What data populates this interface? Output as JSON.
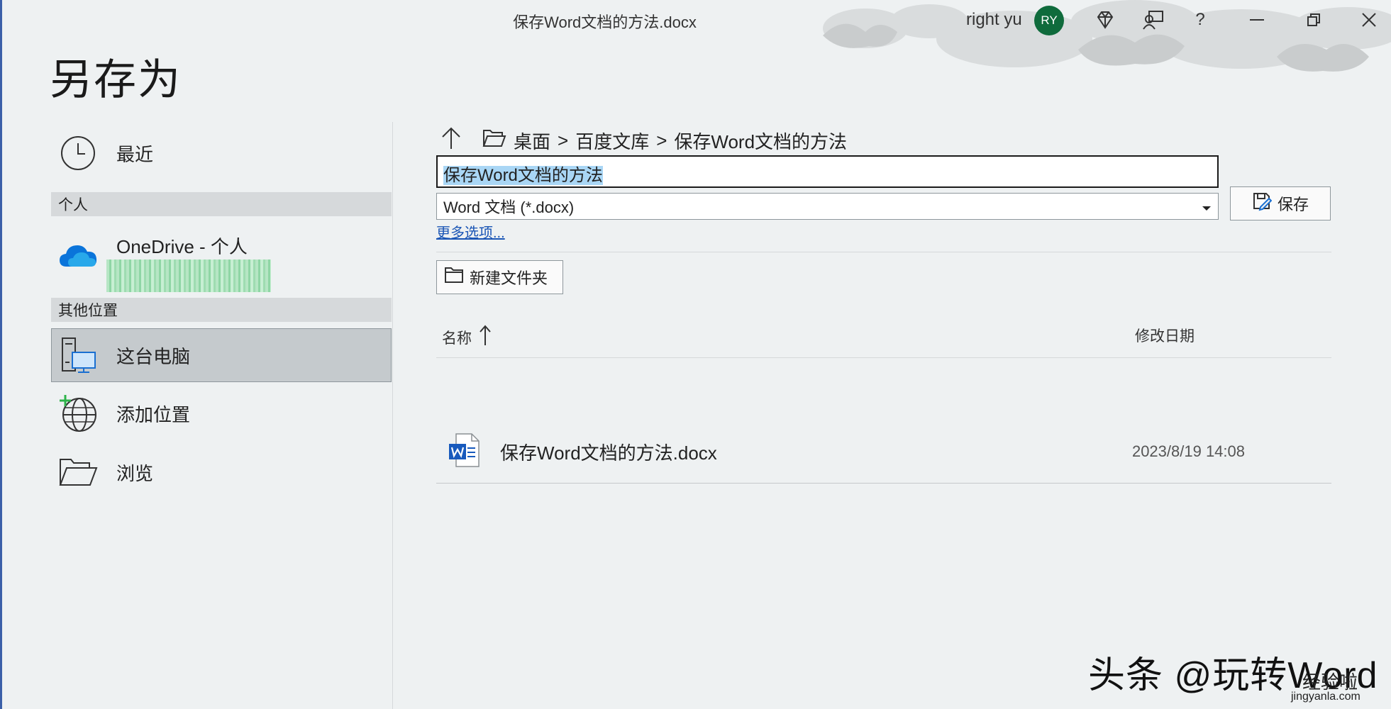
{
  "window": {
    "doc_title": "保存Word文档的方法.docx",
    "user_name": "right yu",
    "avatar_initials": "RY",
    "help_label": "?",
    "controls": [
      "diamond-icon",
      "feedback-icon",
      "help-icon",
      "minimize-icon",
      "restore-icon",
      "close-icon"
    ]
  },
  "page_title": "另存为",
  "sidebar": {
    "recent_label": "最近",
    "section_personal": "个人",
    "onedrive_label": "OneDrive - 个人",
    "section_other": "其他位置",
    "this_pc_label": "这台电脑",
    "add_place_label": "添加位置",
    "browse_label": "浏览"
  },
  "breadcrumb": {
    "parts": [
      "桌面",
      "百度文库",
      "保存Word文档的方法"
    ],
    "separator": ">"
  },
  "save_form": {
    "filename_value": "保存Word文档的方法",
    "filetype_value": "Word 文档 (*.docx)",
    "save_label": "保存",
    "more_options_label": "更多选项...",
    "new_folder_label": "新建文件夹"
  },
  "file_list": {
    "col_name": "名称",
    "col_date": "修改日期",
    "rows": [
      {
        "name": "保存Word文档的方法.docx",
        "modified": "2023/8/19 14:08"
      }
    ]
  },
  "watermark": {
    "main": "头条 @玩转Word",
    "site_cn": "经验啦",
    "site_url": "jingyanla.com"
  },
  "colors": {
    "background": "#eef1f2",
    "avatar_bg": "#0f6b3c",
    "selection": "#a9d6f5",
    "link": "#1a55b5",
    "word_blue": "#185abd",
    "onedrive_blue": "#0a74da"
  }
}
